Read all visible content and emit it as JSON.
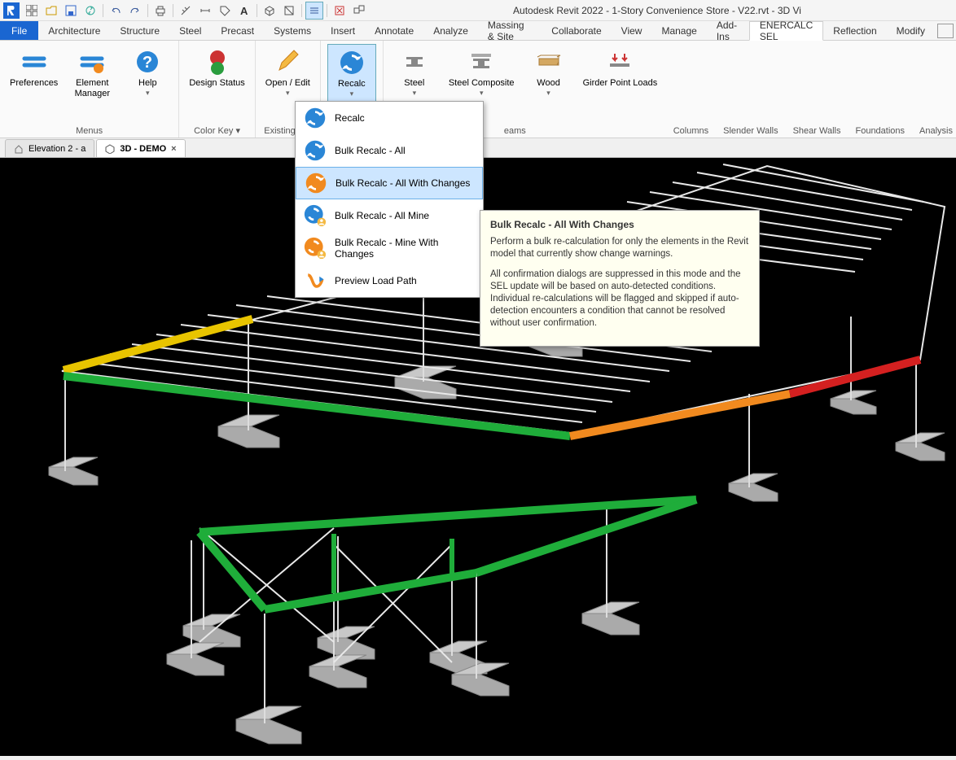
{
  "title": "Autodesk Revit 2022 - 1-Story Convenience Store - V22.rvt - 3D Vi",
  "menubar": {
    "file": "File",
    "items": [
      "Architecture",
      "Structure",
      "Steel",
      "Precast",
      "Systems",
      "Insert",
      "Annotate",
      "Analyze",
      "Massing & Site",
      "Collaborate",
      "View",
      "Manage",
      "Add-Ins",
      "ENERCALC SEL",
      "Reflection",
      "Modify"
    ]
  },
  "ribbon": {
    "preferences": "Preferences",
    "elementManager": "Element\nManager",
    "help": "Help",
    "menus": "Menus",
    "designStatus": "Design Status",
    "colorKey": "Color Key ▾",
    "openEdit": "Open / Edit",
    "existingCalcs": "Existing Cal",
    "recalc": "Recalc",
    "steel": "Steel",
    "steelComposite": "Steel Composite",
    "wood": "Wood",
    "girderPointLoads": "Girder Point Loads",
    "beams": "eams",
    "panels": [
      "Columns",
      "Slender Walls",
      "Shear Walls",
      "Foundations",
      "Analysis"
    ]
  },
  "doctabs": {
    "tab1": "Elevation 2 - a",
    "tab2": "3D - DEMO",
    "close": "×"
  },
  "dropdown": {
    "items": [
      {
        "label": "Recalc",
        "color": "blue"
      },
      {
        "label": "Bulk Recalc - All",
        "color": "blue"
      },
      {
        "label": "Bulk Recalc - All  With Changes",
        "color": "orange",
        "hl": true
      },
      {
        "label": "Bulk Recalc - All Mine",
        "color": "blue"
      },
      {
        "label": "Bulk Recalc - Mine  With Changes",
        "color": "orange"
      },
      {
        "label": "Preview Load Path",
        "color": "path"
      }
    ]
  },
  "tooltip": {
    "title": "Bulk Recalc - All With Changes",
    "p1": "Perform a bulk re-calculation for only the elements in the Revit model that currently show change warnings.",
    "p2": "All confirmation dialogs are suppressed in this mode and the SEL update will be based on auto-detected conditions. Individual re-calculations will be flagged and skipped if auto-detection encounters a condition that cannot be resolved without user confirmation."
  }
}
